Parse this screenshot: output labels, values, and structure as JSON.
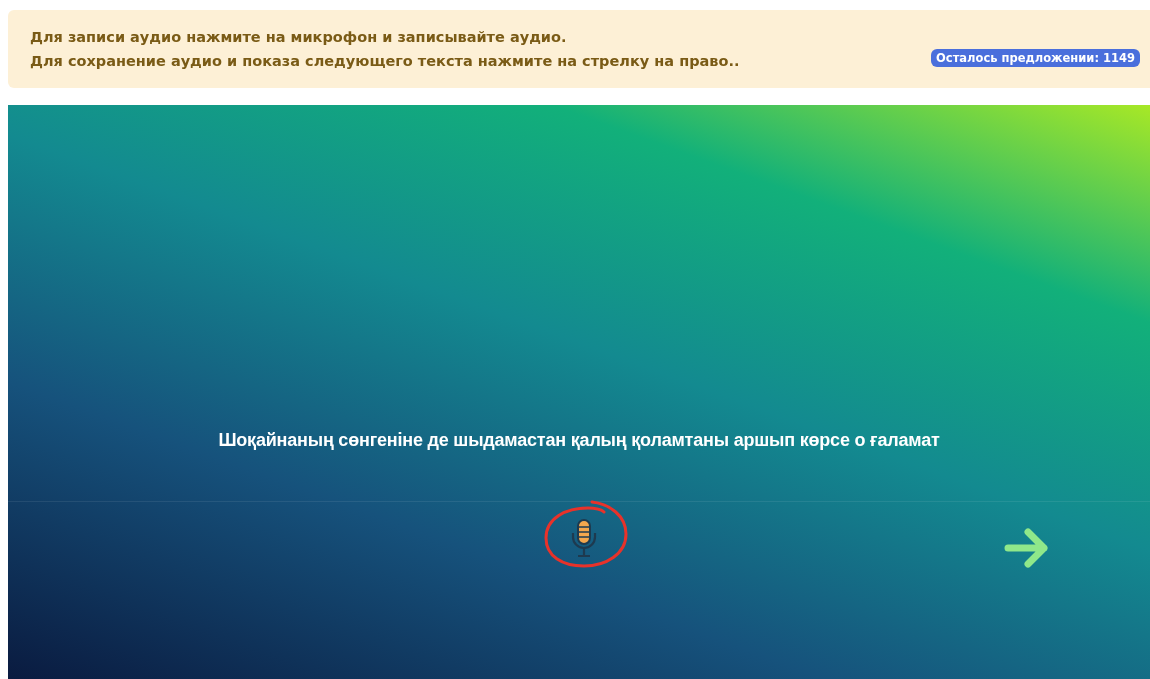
{
  "instructions": [
    "Для записи аудио нажмите на микрофон и записывайте аудио.",
    "Для сохранение аудио и показа следующего текста нажмите на стрелку на право.."
  ],
  "remaining_badge": "Осталось предложении: 1149",
  "sentence": "Шоқайнаның сөнгеніне де шыдамастан қалың қоламтаны аршып көрсе о ғаламат",
  "recorder": {
    "recording": false,
    "highlighted": true
  }
}
